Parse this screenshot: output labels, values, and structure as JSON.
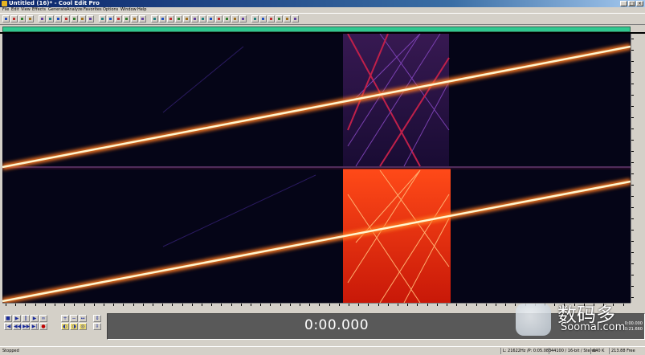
{
  "window": {
    "title": "Untitled (16)* - Cool Edit Pro"
  },
  "menu": [
    "File",
    "Edit",
    "View",
    "Effects",
    "Generate",
    "Analyze",
    "Favorites",
    "Options",
    "Window",
    "Help"
  ],
  "toolbar_icons": [
    "new-file-icon",
    "open-file-icon",
    "save-icon",
    "close-file-icon",
    "multitrack-icon",
    "edit-view-icon",
    "cut-icon",
    "copy-icon",
    "paste-icon",
    "mix-paste-icon",
    "undo-icon",
    "redo-icon",
    "repeat-icon",
    "trim-icon",
    "zoom-icon",
    "waveform-icon",
    "spectral-icon",
    "noise-icon",
    "filter-icon",
    "eq-icon",
    "reverb-icon",
    "delay-icon",
    "chorus-icon",
    "compressor-icon",
    "normalize-icon",
    "amplify-icon",
    "envelope-icon",
    "pitch-icon",
    "stretch-icon",
    "analysis-icon",
    "frequency-icon",
    "phase-icon",
    "stats-icon",
    "settings-icon",
    "help-icon"
  ],
  "transport": {
    "time": "0:00.000",
    "selection_start": "0:00.000",
    "selection_end": "0:21.660"
  },
  "watermark": {
    "chinese": "数码多",
    "url": "Soomal.com"
  },
  "status": {
    "state": "Stopped",
    "cursor": "L: 21622Hz  /P: 0:05.083",
    "format": "44100 / 16-bit / Stereo",
    "size": "640 K",
    "free": "213.88 Free"
  },
  "colors": {
    "overview": "#30c890",
    "spectral_bg": "#050517",
    "sweep_core": "#fff6cf",
    "noise": "#e03010"
  }
}
